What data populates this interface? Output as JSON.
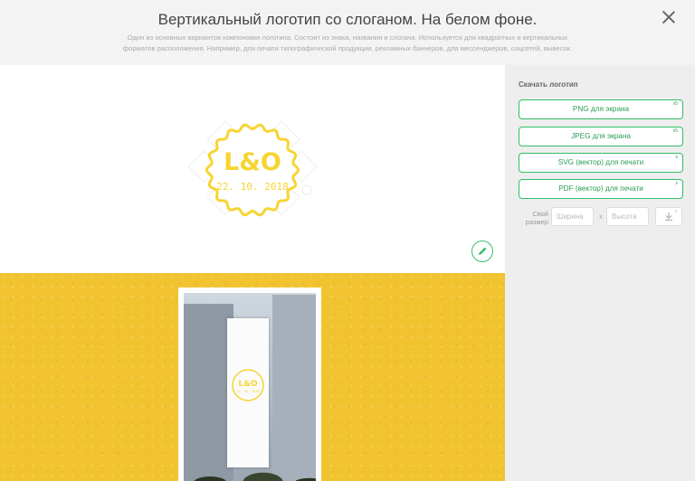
{
  "header": {
    "title": "Вертикальный логотип со слоганом. На белом фоне.",
    "subtitle_line1": "Один из основных вариантов компоновки логотипа. Состоит из знака, названия и слогана. Используется для квадратных и вертикальных",
    "subtitle_line2": "форматов расположения. Например, для печати типографической продукции, рекламных баннеров, для мессенджеров, соцсетей, вывесок."
  },
  "logo": {
    "name": "L&O",
    "slogan": "22. 10. 2018",
    "color": "#f7d433"
  },
  "sidebar": {
    "heading": "Скачать логотип",
    "buttons": [
      {
        "label": "PNG для экрана",
        "badge": "x5"
      },
      {
        "label": "JPEG для экрана",
        "badge": "x5"
      },
      {
        "label": "SVG (вектор) для печати",
        "badge": "x"
      },
      {
        "label": "PDF (вектор) для печати",
        "badge": "x"
      }
    ],
    "custom_size": {
      "label": "Свой размер",
      "width_placeholder": "Ширина",
      "separator": "x",
      "height_placeholder": "Высота",
      "badge": "x"
    }
  },
  "colors": {
    "accent": "#2fbf65",
    "mockup_background": "#f1c330"
  }
}
